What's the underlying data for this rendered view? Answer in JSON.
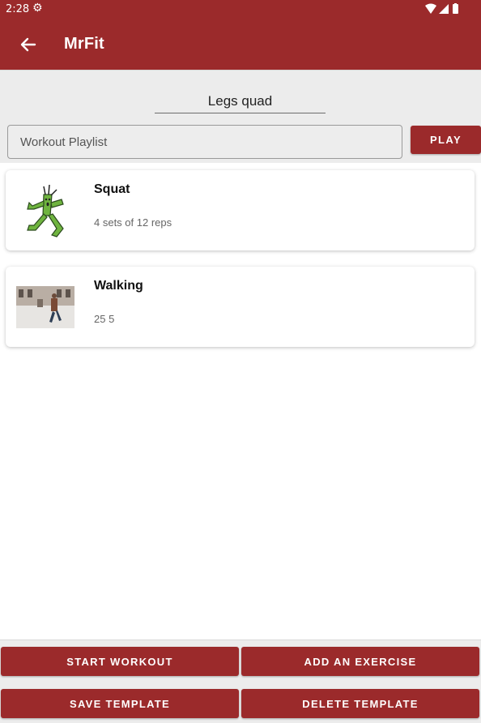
{
  "status_bar": {
    "time": "2:28",
    "settings_icon": "gear-icon",
    "wifi_icon": "wifi-icon",
    "signal_icon": "signal-icon",
    "battery_icon": "battery-icon"
  },
  "app_bar": {
    "back_icon": "arrow-left-icon",
    "title": "MrFit"
  },
  "template": {
    "name": "Legs quad",
    "playlist_placeholder": "Workout Playlist",
    "play_label": "PLAY"
  },
  "exercises": [
    {
      "name": "Squat",
      "detail": "4 sets of 12 reps",
      "thumb": "cactus-figure-image"
    },
    {
      "name": "Walking",
      "detail": "25 5",
      "thumb": "walking-man-photo"
    }
  ],
  "actions": {
    "start_workout": "START WORKOUT",
    "add_exercise": "ADD AN EXERCISE",
    "save_template": "SAVE TEMPLATE",
    "delete_template": "DELETE TEMPLATE"
  },
  "colors": {
    "primary": "#9b2a2b",
    "header_bg": "#ececec",
    "card_bg": "#ffffff"
  }
}
